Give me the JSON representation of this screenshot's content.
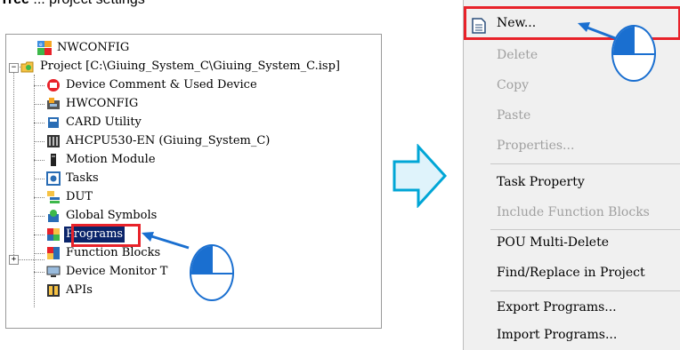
{
  "heading": {
    "bold": "Tree",
    "rest": " ... project settings"
  },
  "tree": {
    "nodes": [
      {
        "id": "nwconfig",
        "label": "NWCONFIG"
      },
      {
        "id": "project",
        "label": "Project [C:\\Giuing_System_C\\Giuing_System_C.isp]"
      },
      {
        "id": "device-comment",
        "label": "Device Comment & Used Device"
      },
      {
        "id": "hwconfig",
        "label": "HWCONFIG"
      },
      {
        "id": "card-utility",
        "label": "CARD Utility"
      },
      {
        "id": "cpu",
        "label": "AHCPU530-EN  (Giuing_System_C)"
      },
      {
        "id": "motion",
        "label": "Motion Module"
      },
      {
        "id": "tasks",
        "label": "Tasks"
      },
      {
        "id": "dut",
        "label": "DUT"
      },
      {
        "id": "global-symbols",
        "label": "Global Symbols"
      },
      {
        "id": "programs",
        "label": "Programs"
      },
      {
        "id": "function-blocks",
        "label": "Function Blocks"
      },
      {
        "id": "device-monitor",
        "label": "Device Monitor T"
      },
      {
        "id": "apis",
        "label": "APIs"
      }
    ],
    "expander_minus": "−",
    "expander_plus": "+"
  },
  "context_menu": {
    "items": [
      {
        "label": "New...",
        "enabled": true
      },
      {
        "label": "Delete",
        "enabled": false
      },
      {
        "label": "Copy",
        "enabled": false
      },
      {
        "label": "Paste",
        "enabled": false
      },
      {
        "label": "Properties...",
        "enabled": false
      },
      {
        "label": "Task Property",
        "enabled": true
      },
      {
        "label": "Include Function Blocks",
        "enabled": false
      },
      {
        "label": "POU Multi-Delete",
        "enabled": true
      },
      {
        "label": "Find/Replace in Project",
        "enabled": true
      },
      {
        "label": "Export Programs...",
        "enabled": true
      },
      {
        "label": "Import Programs...",
        "enabled": true
      }
    ]
  },
  "colors": {
    "highlight": "#e8222a",
    "cursor_blue": "#1a6fd0",
    "arrow_fill": "#dff3fb",
    "arrow_stroke": "#00a6d6"
  },
  "icons": [
    "nwconfig-icon",
    "project-folder-icon",
    "device-comment-icon",
    "hwconfig-icon",
    "card-icon",
    "cpu-icon",
    "motion-icon",
    "tasks-icon",
    "dut-icon",
    "global-symbols-icon",
    "programs-icon",
    "function-blocks-icon",
    "device-monitor-icon",
    "apis-icon",
    "new-document-icon",
    "mouse-left-click-icon",
    "right-arrow-icon"
  ]
}
